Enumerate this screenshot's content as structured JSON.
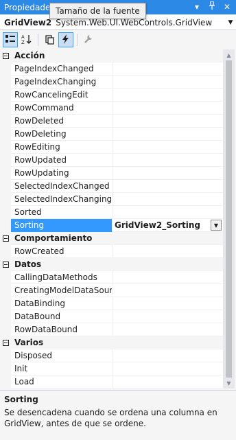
{
  "window": {
    "title": "Propiedades",
    "controls": {
      "dropdown": "▾",
      "pin": "📌",
      "close": "✕"
    }
  },
  "tooltip": {
    "text": "Tamaño de la fuente"
  },
  "object_selector": {
    "name": "GridView2",
    "type": "System.Web.UI.WebControls.GridView"
  },
  "toolbar": {
    "buttons": [
      {
        "icon": "categorized-icon",
        "active": true
      },
      {
        "icon": "alphabetical-icon",
        "active": false
      },
      {
        "icon": "property-pages-icon",
        "active": false
      },
      {
        "icon": "events-lightning-icon",
        "active": true
      },
      {
        "icon": "wrench-icon",
        "active": false
      }
    ]
  },
  "categories": [
    {
      "name": "Acción",
      "items": [
        {
          "name": "PageIndexChanged",
          "value": ""
        },
        {
          "name": "PageIndexChanging",
          "value": ""
        },
        {
          "name": "RowCancelingEdit",
          "value": ""
        },
        {
          "name": "RowCommand",
          "value": ""
        },
        {
          "name": "RowDeleted",
          "value": ""
        },
        {
          "name": "RowDeleting",
          "value": ""
        },
        {
          "name": "RowEditing",
          "value": ""
        },
        {
          "name": "RowUpdated",
          "value": ""
        },
        {
          "name": "RowUpdating",
          "value": ""
        },
        {
          "name": "SelectedIndexChanged",
          "value": ""
        },
        {
          "name": "SelectedIndexChanging",
          "value": ""
        },
        {
          "name": "Sorted",
          "value": ""
        },
        {
          "name": "Sorting",
          "value": "GridView2_Sorting",
          "selected": true
        }
      ]
    },
    {
      "name": "Comportamiento",
      "items": [
        {
          "name": "RowCreated",
          "value": ""
        }
      ]
    },
    {
      "name": "Datos",
      "items": [
        {
          "name": "CallingDataMethods",
          "value": ""
        },
        {
          "name": "CreatingModelDataSource",
          "value": ""
        },
        {
          "name": "DataBinding",
          "value": ""
        },
        {
          "name": "DataBound",
          "value": ""
        },
        {
          "name": "RowDataBound",
          "value": ""
        }
      ]
    },
    {
      "name": "Varios",
      "items": [
        {
          "name": "Disposed",
          "value": ""
        },
        {
          "name": "Init",
          "value": ""
        },
        {
          "name": "Load",
          "value": ""
        }
      ]
    }
  ],
  "description": {
    "title": "Sorting",
    "text": "Se desencadena cuando se ordena una columna en GridView, antes de que se ordene."
  },
  "colors": {
    "titlebar": "#2d89e6",
    "selection": "#3399ff",
    "background": "#f5f5f5"
  }
}
